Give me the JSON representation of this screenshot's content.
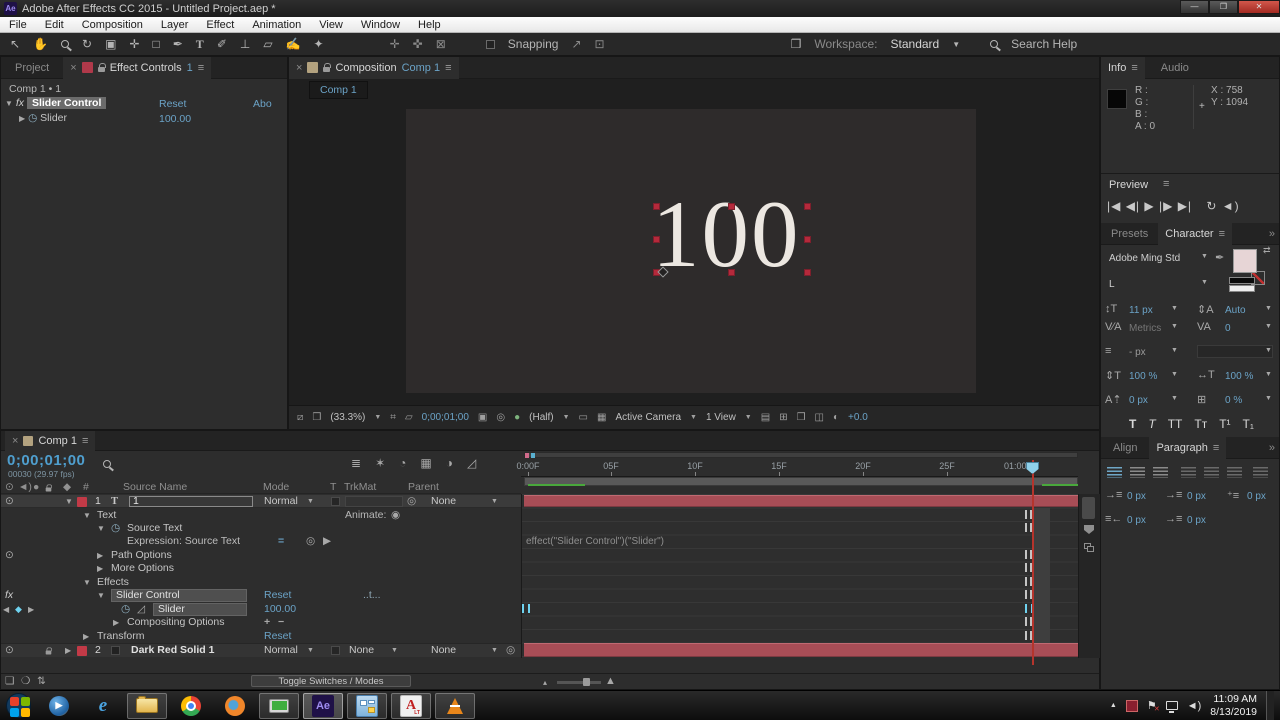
{
  "titlebar": {
    "icon_label": "Ae",
    "title": "Adobe After Effects CC 2015 - Untitled Project.aep *"
  },
  "menu": {
    "items": [
      "File",
      "Edit",
      "Composition",
      "Layer",
      "Effect",
      "Animation",
      "View",
      "Window",
      "Help"
    ]
  },
  "toolbar": {
    "snapping": "Snapping",
    "workspace_label": "Workspace:",
    "workspace_value": "Standard",
    "search_label": "Search Help"
  },
  "effect_controls": {
    "tab_inactive": "Project",
    "tab_title": "Effect Controls",
    "tab_badge": "1",
    "comp_ref": "Comp 1 • 1",
    "effect_name": "Slider Control",
    "reset": "Reset",
    "about": "Abo",
    "param": "Slider",
    "value": "100.00"
  },
  "composition": {
    "header_label": "Composition",
    "header_comp": "Comp 1",
    "tab": "Comp 1",
    "canvas_text": "100",
    "status": {
      "zoom": "(33.3%)",
      "timecode": "0;00;01;00",
      "resolution": "(Half)",
      "camera": "Active Camera",
      "view": "1 View",
      "exposure": "+0.0"
    }
  },
  "info": {
    "tab": "Info",
    "tab_audio": "Audio",
    "r": "R :",
    "g": "G :",
    "b": "B :",
    "a": "A : 0",
    "x": "X : 758",
    "y": "Y : 1094"
  },
  "preview": {
    "title": "Preview"
  },
  "character": {
    "tab_presets": "Presets",
    "tab": "Character",
    "font_family": "Adobe Ming Std",
    "font_style": "L",
    "size": "11 px",
    "leading": "Auto",
    "kerning": "Metrics",
    "tracking": "0",
    "grid": "- px",
    "v_scale": "100 %",
    "h_scale": "100 %",
    "baseline": "0 px",
    "tsume": "0 %",
    "styles": [
      "T",
      "T",
      "TT",
      "Tᴛ",
      "T¹",
      "T₁"
    ]
  },
  "paragraph": {
    "tab_align": "Align",
    "tab": "Paragraph",
    "indent1": "0 px",
    "indent2": "0 px",
    "indent3": "0 px",
    "indent4": "0 px",
    "indent5": "0 px"
  },
  "timeline": {
    "tab": "Comp 1",
    "timecode": "0;00;01;00",
    "timecode_sub": "00030 (29.97 fps)",
    "col_num": "#",
    "col_source": "Source Name",
    "col_mode": "Mode",
    "col_t": "T",
    "col_trkmat": "TrkMat",
    "col_parent": "Parent",
    "ruler": [
      "0:00F",
      "05F",
      "10F",
      "15F",
      "20F",
      "25F",
      "01:00F"
    ],
    "layer1": {
      "num": "1",
      "name": "1",
      "mode": "Normal",
      "parent": "None"
    },
    "rows": [
      {
        "label": "Text"
      },
      {
        "label": "Source Text"
      },
      {
        "label": "Expression: Source Text"
      },
      {
        "label": "Path Options"
      },
      {
        "label": "More Options"
      },
      {
        "label": "Effects"
      },
      {
        "label": "Slider Control",
        "value": "Reset",
        "extra": "..t..."
      },
      {
        "label": "Slider",
        "value": "100.00"
      },
      {
        "label": "Compositing Options"
      },
      {
        "label": "Transform",
        "value": "Reset"
      }
    ],
    "animate_label": "Animate:",
    "expression": "effect(\"Slider Control\")(\"Slider\")",
    "layer2": {
      "num": "2",
      "name": "Dark Red Solid 1",
      "mode": "Normal",
      "trkmat": "None",
      "parent": "None"
    },
    "toggle": "Toggle Switches / Modes"
  },
  "taskbar": {
    "time": "11:09 AM",
    "date": "8/13/2019",
    "ae_label": "Ae",
    "ie_label": "e",
    "acad_label": "A",
    "acad_sub": "LT"
  }
}
